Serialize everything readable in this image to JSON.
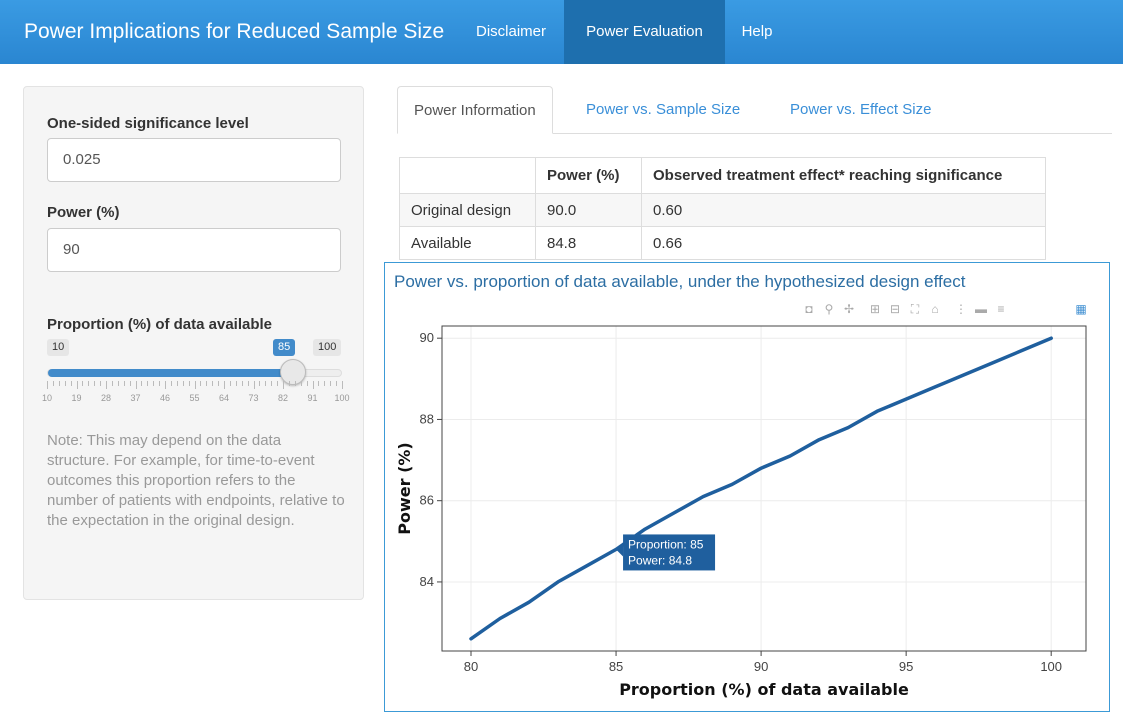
{
  "app": {
    "title": "Power Implications for Reduced Sample Size",
    "nav": [
      "Disclaimer",
      "Power Evaluation",
      "Help"
    ]
  },
  "sidebar": {
    "alpha_label": "One-sided significance level",
    "alpha_value": "0.025",
    "power_label": "Power (%)",
    "power_value": "90",
    "slider": {
      "label": "Proportion (%) of data available",
      "min": "10",
      "max": "100",
      "value": 85,
      "value_text": "85",
      "ticks": [
        "10",
        "19",
        "28",
        "37",
        "46",
        "55",
        "64",
        "73",
        "82",
        "91",
        "100"
      ]
    },
    "note": "Note: This may depend on the data structure. For example, for time-to-event outcomes this proportion refers to the number of patients with endpoints, relative to the expectation in the original design."
  },
  "tabs": [
    "Power Information",
    "Power vs. Sample Size",
    "Power vs. Effect Size"
  ],
  "table": {
    "headers": [
      "",
      "Power (%)",
      "Observed treatment effect* reaching significance"
    ],
    "rows": [
      [
        "Original design",
        "90.0",
        "0.60"
      ],
      [
        "Available",
        "84.8",
        "0.66"
      ]
    ]
  },
  "chart": {
    "title": "Power vs. proportion of data available, under the hypothesized design effect",
    "tooltip": {
      "line1": "Proportion:  85",
      "line2": "Power: 84.8"
    },
    "modebar_icons": [
      "camera-icon",
      "zoom-icon",
      "pan-icon",
      "zoom-in-icon",
      "zoom-out-icon",
      "autoscale-icon",
      "reset-axes-icon",
      "spike-lines-icon",
      "hover-closest-icon",
      "hover-compare-icon",
      "plotly-logo-icon"
    ]
  },
  "chart_data": {
    "type": "line",
    "title": "",
    "xlabel": "Proportion (%) of data available",
    "ylabel": "Power (%)",
    "xlim": [
      79,
      101.2
    ],
    "ylim": [
      82.3,
      90.3
    ],
    "xticks": [
      "80",
      "85",
      "90",
      "95",
      "100"
    ],
    "yticks": [
      "84",
      "86",
      "88",
      "90"
    ],
    "grid": true,
    "x": [
      80,
      81,
      82,
      83,
      84,
      85,
      86,
      87,
      88,
      89,
      90,
      91,
      92,
      93,
      94,
      95,
      96,
      97,
      98,
      99,
      100
    ],
    "series": [
      {
        "values": [
          82.6,
          83.1,
          83.5,
          84.0,
          84.4,
          84.8,
          85.3,
          85.7,
          86.1,
          86.4,
          86.8,
          87.1,
          87.5,
          87.8,
          88.2,
          88.5,
          88.8,
          89.1,
          89.4,
          89.7,
          90.0
        ]
      }
    ],
    "highlight": {
      "x": 85,
      "y": 84.8
    },
    "line_color": "#1f5f9e"
  }
}
